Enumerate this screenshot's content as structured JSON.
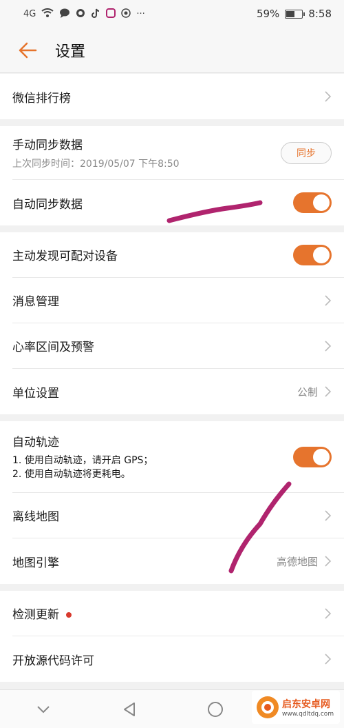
{
  "status_bar": {
    "network": "4G",
    "battery_percent": "59%",
    "battery_level": 0.59,
    "time": "8:58",
    "more": "···"
  },
  "app_bar": {
    "title": "设置"
  },
  "groups": [
    [
      {
        "title": "微信排行榜",
        "control": "chevron"
      }
    ],
    [
      {
        "title": "手动同步数据",
        "subtitle": "上次同步时间：2019/05/07 下午8:50",
        "control": "button",
        "button_label": "同步"
      },
      {
        "title": "自动同步数据",
        "control": "toggle",
        "on": true
      }
    ],
    [
      {
        "title": "主动发现可配对设备",
        "control": "toggle",
        "on": true
      },
      {
        "title": "消息管理",
        "control": "chevron"
      },
      {
        "title": "心率区间及预警",
        "control": "chevron"
      },
      {
        "title": "单位设置",
        "value": "公制",
        "control": "chevron"
      }
    ],
    [
      {
        "title": "自动轨迹",
        "desc1": "1. 使用自动轨迹，请开启 GPS；",
        "desc2": "2. 使用自动轨迹将更耗电。",
        "control": "toggle",
        "on": true
      },
      {
        "title": "离线地图",
        "control": "chevron"
      },
      {
        "title": "地图引擎",
        "value": "高德地图",
        "control": "chevron"
      }
    ],
    [
      {
        "title": "检测更新",
        "badge": "red-dot",
        "control": "chevron"
      },
      {
        "title": "开放源代码许可",
        "control": "chevron"
      }
    ]
  ],
  "nav_bar": [
    "chevron-down-icon",
    "back-triangle-icon",
    "home-circle-icon",
    "recents-square-icon"
  ],
  "watermark": {
    "name": "启东安卓网",
    "url": "www.qdltdq.com"
  },
  "colors": {
    "accent": "#e6742d",
    "badge": "#d83a2e",
    "annotation": "#b0246e"
  }
}
